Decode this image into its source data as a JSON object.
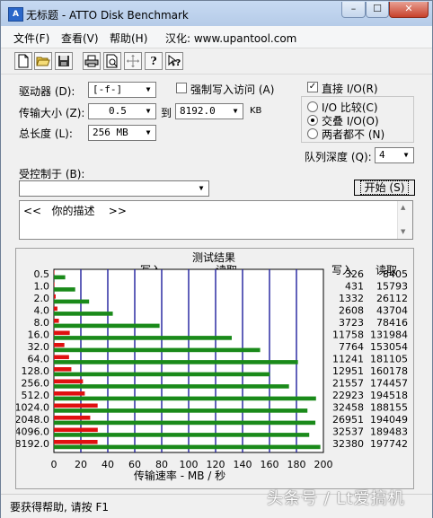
{
  "window": {
    "title": "无标题 - ATTO Disk Benchmark",
    "minimize_symbol": "–",
    "maximize_symbol": "☐",
    "close_symbol": "✕"
  },
  "menu": {
    "items": [
      "文件(F)",
      "查看(V)",
      "帮助(H)"
    ],
    "localization": "汉化: www.upantool.com"
  },
  "toolbar": {
    "icons": [
      "new-file-icon",
      "open-folder-icon",
      "save-icon",
      "print-icon",
      "print-preview-icon",
      "move-icon",
      "help-icon",
      "context-help-icon"
    ]
  },
  "settings": {
    "drive_label": "驱动器 (D):",
    "drive_value": "[-f-]",
    "force_write_label": "强制写入访问 (A)",
    "transfer_label": "传输大小 (Z):",
    "transfer_from": "0.5",
    "to_label": "到",
    "transfer_to": "8192.0",
    "unit": "KB",
    "total_label": "总长度 (L):",
    "total_value": "256 MB",
    "direct_io_label": "直接 I/O(R)",
    "io_compare_label": "I/O 比较(C)",
    "overlapped_io_label": "交叠 I/O(O)",
    "neither_label": "两者都不 (N)",
    "queue_label": "队列深度 (Q):",
    "queue_value": "4",
    "controlled_by_label": "受控制于 (B):",
    "controlled_by_value": "",
    "start_label": "开始 (S)",
    "description": "<<   你的描述    >>",
    "checkmark": "✓"
  },
  "results": {
    "title": "测试结果",
    "write_legend": "写入",
    "read_legend": "读取",
    "write_header": "写入",
    "read_header": "读取"
  },
  "chart_data": {
    "type": "bar",
    "orientation": "horizontal",
    "title": "测试结果",
    "xlabel": "传输速率 - MB / 秒",
    "ylabel": "",
    "xlim": [
      0,
      200
    ],
    "xticks": [
      0,
      20,
      40,
      60,
      80,
      100,
      120,
      140,
      160,
      180,
      200
    ],
    "grid": true,
    "legend": "top",
    "categories": [
      "0.5",
      "1.0",
      "2.0",
      "4.0",
      "8.0",
      "16.0",
      "32.0",
      "64.0",
      "128.0",
      "256.0",
      "512.0",
      "1024.0",
      "2048.0",
      "4096.0",
      "8192.0"
    ],
    "series": [
      {
        "name": "写入",
        "color": "#e01010",
        "values": [
          326,
          431,
          1332,
          2608,
          3723,
          11758,
          7764,
          11241,
          12951,
          21557,
          22923,
          32458,
          26951,
          32537,
          32380
        ]
      },
      {
        "name": "读取",
        "color": "#1a8a1a",
        "values": [
          8405,
          15793,
          26112,
          43704,
          78416,
          131984,
          153054,
          181105,
          160178,
          174457,
          194518,
          188155,
          194049,
          189483,
          197742
        ]
      }
    ]
  },
  "statusbar": {
    "text": "要获得帮助, 请按 F1"
  },
  "watermark": {
    "text": "头条号 / Lt爱搞机"
  }
}
